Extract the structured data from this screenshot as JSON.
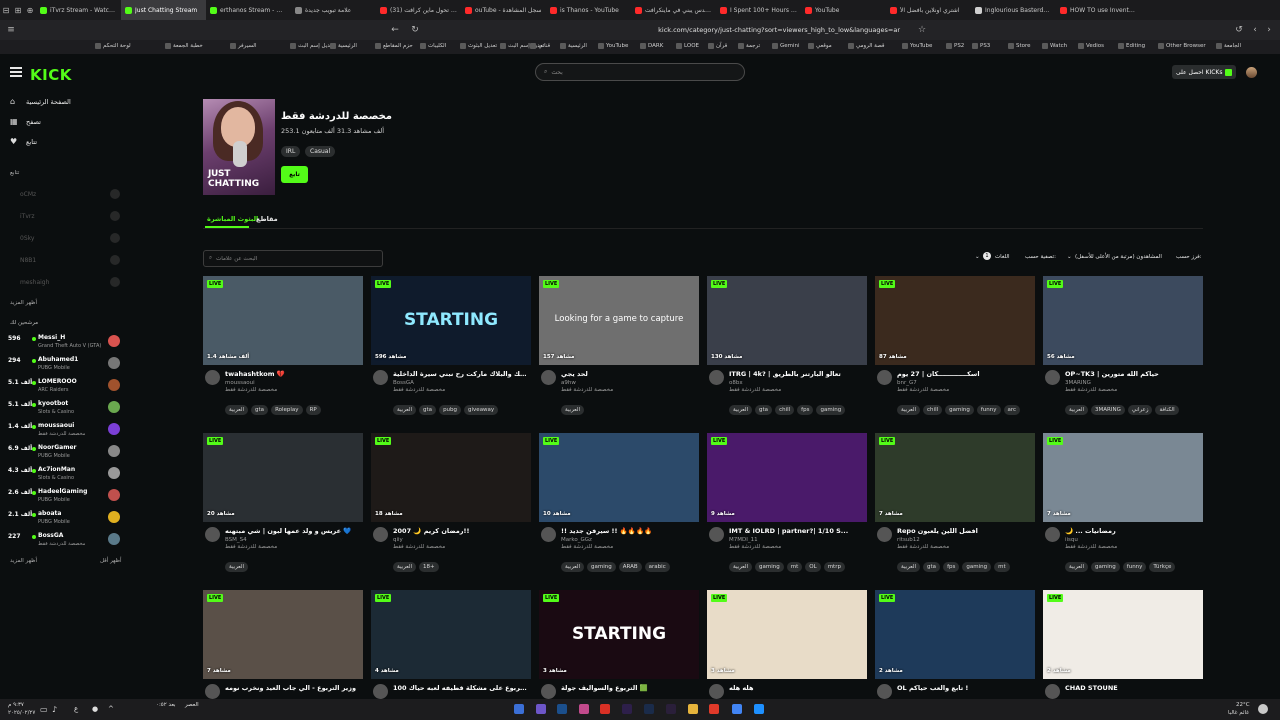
{
  "browser": {
    "tabs": [
      {
        "label": "iTvrz Stream - Watch Li",
        "color": "#53fc18",
        "active": false
      },
      {
        "label": "Just Chatting Stream",
        "color": "#53fc18",
        "active": true
      },
      {
        "label": "erthanos Stream - Watc",
        "color": "#53fc18",
        "active": false
      },
      {
        "label": "علامة تبويب جديدة",
        "color": "#888888",
        "active": false
      },
      {
        "label": "(31) كيف تحول ماين كرافت",
        "color": "#ff2a2a",
        "active": false
      },
      {
        "label": "ouTube - سجل المشاهدة",
        "color": "#ff2a2a",
        "active": false
      },
      {
        "label": "is Thanos - YouTube",
        "color": "#ff2a2a",
        "active": false
      },
      {
        "label": "مهندس يبني في ماينكرافت",
        "color": "#ff2a2a",
        "active": false
      },
      {
        "label": "I Spent 100+ Hours on",
        "color": "#ff2a2a",
        "active": false
      },
      {
        "label": "YouTube",
        "color": "#ff2a2a",
        "active": false
      },
      {
        "label": "اشتري اونلاين بأفضل الأ",
        "color": "#ff2a2a",
        "active": false
      },
      {
        "label": "Inglourious Basterds (2",
        "color": "#cfcfcf",
        "active": false
      },
      {
        "label": "HOW TO use Inventory",
        "color": "#ff2a2a",
        "active": false
      }
    ],
    "url": "kick.com/category/just-chatting?sort=viewers_high_to_low&languages=ar",
    "bookmarks": [
      "لوحة التحكم",
      "خطبة الجمعة",
      "السيرفر",
      "تعديل إسم البث",
      "الرئيسية",
      "حزم المقاطع",
      "الكليبات",
      "تعديل البثوث",
      "تعديل إسم البث",
      "قناتي",
      "الرئيسية",
      "YouTube",
      "DARK",
      "LOOE",
      "قرآن",
      "ترجمة",
      "Gemini",
      "موقعي",
      "قصة الرومي",
      "YouTube",
      "PS2",
      "PS3",
      "Store",
      "Watch",
      "Vedios",
      "Editing",
      "Other Browser",
      "الجامعة"
    ]
  },
  "header": {
    "logo": "KICK",
    "search_placeholder": "بحث",
    "get_kicks": "احصل على KICKs"
  },
  "sidebar": {
    "nav": [
      {
        "label": "الصفحة الرئيسية",
        "icon": "home-icon",
        "glyph": "⌂"
      },
      {
        "label": "تصفح",
        "icon": "browse-icon",
        "glyph": "▦"
      },
      {
        "label": "تتابع",
        "icon": "heart-icon",
        "glyph": "♥"
      }
    ],
    "following_title": "تتابع",
    "following": [
      "oCMz",
      "iTvrz",
      "0Sky",
      "N8B1",
      "meshaigh"
    ],
    "show_more": "أظهر المزيد",
    "recommended_title": "مرشحين لك",
    "recommended": [
      {
        "viewers": "596",
        "name": "Messi_H",
        "cat": "Grand Theft Auto V (GTA)",
        "color": "#d9534f"
      },
      {
        "viewers": "294",
        "name": "Abuhamed1",
        "cat": "PUBG Mobile",
        "color": "#777777"
      },
      {
        "viewers": "5.1 ألف",
        "name": "LOMEROOO",
        "cat": "ARC Raiders",
        "color": "#a0522d"
      },
      {
        "viewers": "5.1 ألف",
        "name": "kyootbot",
        "cat": "Slots & Casino",
        "color": "#6aa84f"
      },
      {
        "viewers": "1.4 ألف",
        "name": "moussaoui",
        "cat": "مخصصة للدردشة فقط",
        "color": "#7b3fd6"
      },
      {
        "viewers": "6.9 ألف",
        "name": "NoorGamer",
        "cat": "PUBG Mobile",
        "color": "#888888"
      },
      {
        "viewers": "4.3 ألف",
        "name": "Ac7ionMan",
        "cat": "Slots & Casino",
        "color": "#999999"
      },
      {
        "viewers": "2.6 ألف",
        "name": "HadeelGaming",
        "cat": "PUBG Mobile",
        "color": "#c0504d"
      },
      {
        "viewers": "2.1 ألف",
        "name": "aboata",
        "cat": "PUBG Mobile",
        "color": "#e0b020"
      },
      {
        "viewers": "227",
        "name": "BossGA",
        "cat": "مخصصة للدردشة فقط",
        "color": "#5a7a8a"
      }
    ],
    "show_more_bottom": "أظهر المزيد",
    "show_less": "أظهر أقل"
  },
  "category": {
    "image_text_1": "JUST",
    "image_text_2": "CHATTING",
    "title": "مخصصة للدردشة فقط",
    "stats": "253.1 ألف مشاهد 31.3 ألف متابعون",
    "tags": [
      "Casual",
      "IRL"
    ],
    "follow": "تابع"
  },
  "tabs": {
    "live": "البثوث المباشرة",
    "clips": "مقاطع"
  },
  "filters": {
    "tag_search_placeholder": "البحث عن علامات",
    "sort_label": "فرز حسب:",
    "sort_value": "المشاهدون (مرتبة من الأعلى للأسفل)",
    "filter_label": "تصفية حسب:",
    "language": "اللغات",
    "language_count": "1"
  },
  "live_label": "LIVE",
  "cards": [
    {
      "views": "1.4 ألف مشاهد",
      "title": "twahashtkom 💔",
      "channel": "moussaoui",
      "category": "مخصصة للدردشة فقط",
      "tags": [
        "العربية",
        "gta",
        "Roleplay",
        "RP"
      ],
      "bg": "#4a5a66",
      "thumb_text": ""
    },
    {
      "views": "596 مشاهد",
      "title": "البنك والبلاك ماركت رح نبني سيرة الداخلية",
      "channel": "BossGA",
      "category": "مخصصة للدردشة فقط",
      "tags": [
        "العربية",
        "gta",
        "pubg",
        "giveaway"
      ],
      "bg": "#0f1b2c",
      "thumb_text": "STARTING"
    },
    {
      "views": "157 مشاهد",
      "title": "لحد يجي",
      "channel": "a9hw",
      "category": "مخصصة للدردشة فقط",
      "tags": [
        "العربية"
      ],
      "bg": "#6f6f6f",
      "thumb_text": "Looking for a game to capture"
    },
    {
      "views": "130 مشاهد",
      "title": "ITRG | 4k? | تعالو البارتنر بالطريق",
      "channel": "o8bx",
      "category": "مخصصة للدردشة فقط",
      "tags": [
        "العربية",
        "gta",
        "chill",
        "fps",
        "gaming"
      ],
      "bg": "#3a3f4a",
      "thumb_text": ""
    },
    {
      "views": "87 مشاهد",
      "title": "اسكـــــــــــــكان | 27 يوم",
      "channel": "bnr_G7",
      "category": "مخصصة للدردشة فقط",
      "tags": [
        "العربية",
        "chill",
        "gaming",
        "funny",
        "arc"
      ],
      "bg": "#3b2a1e",
      "thumb_text": ""
    },
    {
      "views": "56 مشاهد",
      "title": "OP~TK3 | حياكم الله متورين",
      "channel": "3MARING",
      "category": "مخصصة للدردشة فقط",
      "tags": [
        "العربية",
        "3MARING",
        "زعراني",
        "الكنافة"
      ],
      "bg": "#3c4a5e",
      "thumb_text": ""
    },
    {
      "views": "20 مشاهد",
      "title": "عريس و ولد عمها لبون | شي مبتهنه 💙",
      "channel": "BSM_S4",
      "category": "مخصصة للدردشة فقط",
      "tags": [
        "العربية"
      ],
      "bg": "#2a2f33",
      "thumb_text": ""
    },
    {
      "views": "18 مشاهد",
      "title": "رمضان كريم 🌙 2007!!",
      "channel": "qiiy",
      "category": "مخصصة للدردشة فقط",
      "tags": [
        "العربية",
        "18+"
      ],
      "bg": "#1e1a18",
      "thumb_text": ""
    },
    {
      "views": "10 مشاهد",
      "title": "!! سيرفن جديد !! 🔥🔥🔥🔥",
      "channel": "Marko_GGz",
      "category": "مخصصة للدردشة فقط",
      "tags": [
        "العربية",
        "gaming",
        "ARAB",
        "arabic"
      ],
      "bg": "#2c4a6a",
      "thumb_text": ""
    },
    {
      "views": "9 مشاهد",
      "title": "IMT & IOLRD | partner?| 1/10 S...",
      "channel": "M7MDI_11",
      "category": "مخصصة للدردشة فقط",
      "tags": [
        "العربية",
        "gaming",
        "mt",
        "OL",
        "mtrp"
      ],
      "bg": "#4a1a6a",
      "thumb_text": ""
    },
    {
      "views": "7 مشاهد",
      "title": "Repo افضل اللين يلعبون",
      "channel": "ritsub12",
      "category": "مخصصة للدردشة فقط",
      "tags": [
        "العربية",
        "gta",
        "fps",
        "gaming",
        "mt"
      ],
      "bg": "#2e3b2a",
      "thumb_text": ""
    },
    {
      "views": "7 مشاهد",
      "title": "🌙 ... رمضانيات",
      "channel": "iisqu",
      "category": "مخصصة للدردشة فقط",
      "tags": [
        "العربية",
        "gaming",
        "funny",
        "Türkçe"
      ],
      "bg": "#7a8894",
      "thumb_text": ""
    },
    {
      "views": "7 مشاهد",
      "title": "وزير التربوع - الي جاب العيد ونخرب نومه",
      "channel": "",
      "category": "",
      "tags": [],
      "bg": "#5a5048",
      "thumb_text": ""
    },
    {
      "views": "4 مشاهد",
      "title": "التربوع على مشكلة قطيفه لعبه حياك 100?!",
      "channel": "",
      "category": "",
      "tags": [],
      "bg": "#1c2a35",
      "thumb_text": ""
    },
    {
      "views": "3 مشاهد",
      "title": "التربوع والسواليف جولة 🟩",
      "channel": "",
      "category": "",
      "tags": [],
      "bg": "#1a0a12",
      "thumb_text": "STARTING"
    },
    {
      "views": "3 مشاهد",
      "title": "هله هله",
      "channel": "",
      "category": "",
      "tags": [],
      "bg": "#e8dcc8",
      "thumb_text": ""
    },
    {
      "views": "2 مشاهد",
      "title": "OL تابع والعب حياكم !",
      "channel": "",
      "category": "",
      "tags": [],
      "bg": "#1e3a5a",
      "thumb_text": ""
    },
    {
      "views": "2 مشاهد",
      "title": "CHAD STOUNE",
      "channel": "",
      "category": "",
      "tags": [],
      "bg": "#f0ece6",
      "thumb_text": ""
    }
  ],
  "taskbar": {
    "clock": "٩:٣٧ م",
    "date": "٢٠٢٥/٠٢/٢٧",
    "weather_temp": "22°C",
    "weather_desc": "غائم غالبا",
    "prayer": "العصر",
    "prayer_time": "بعد ٠:٥٢"
  }
}
